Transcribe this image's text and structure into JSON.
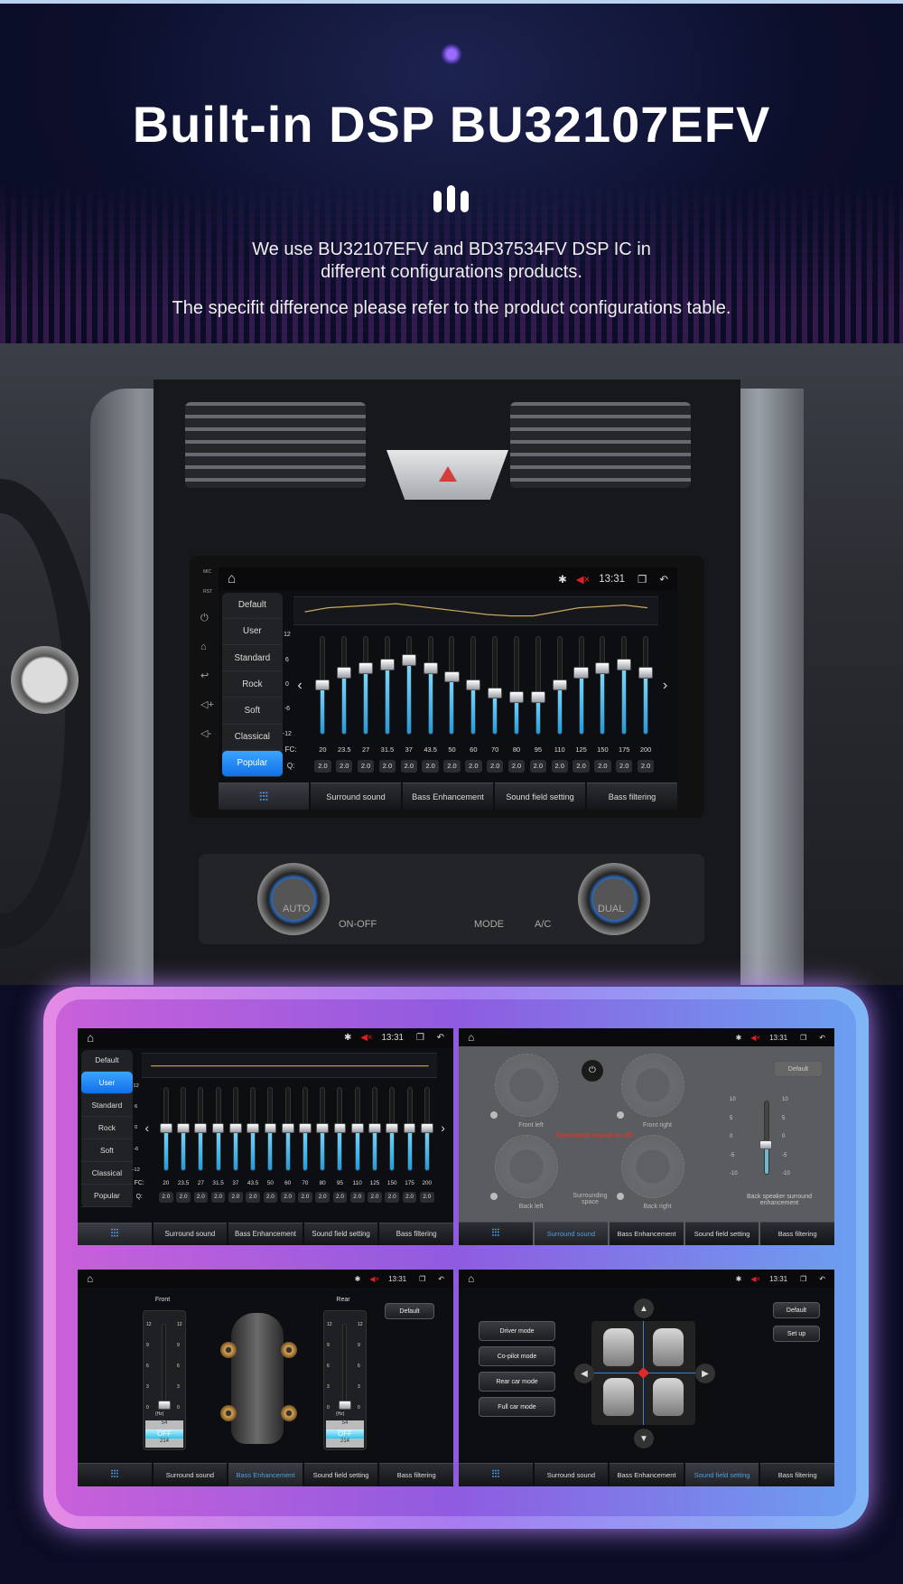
{
  "hero": {
    "title": "Built-in DSP BU32107EFV",
    "line1": "We use BU32107EFV and BD37534FV DSP IC in",
    "line2": "different configurations products.",
    "line3": "The specifit difference please refer to the product configurations table."
  },
  "dashboard": {
    "climate_labels": [
      "AUTO",
      "ON-OFF",
      "MODE",
      "A/C",
      "DUAL"
    ],
    "side_labels": [
      "MIC",
      "RST"
    ]
  },
  "status": {
    "time": "13:31",
    "icons": [
      "home-icon",
      "bluetooth-icon",
      "mute-icon",
      "recent-apps-icon",
      "back-icon"
    ],
    "mute_color": "#e02020"
  },
  "tabs": {
    "eq_icon": "equalizer-icon",
    "items": [
      "Surround sound",
      "Bass Enhancement",
      "Sound field setting",
      "Bass filtering"
    ]
  },
  "equalizer": {
    "presets": [
      "Default",
      "User",
      "Standard",
      "Rock",
      "Soft",
      "Classical",
      "Popular"
    ],
    "scale": [
      "12",
      "6",
      "0",
      "-6",
      "-12"
    ],
    "range_db": [
      -12,
      12
    ],
    "fc_label": "FC:",
    "q_label": "Q:",
    "frequencies": [
      "20",
      "23.5",
      "27",
      "31.5",
      "37",
      "43.5",
      "50",
      "60",
      "70",
      "80",
      "95",
      "110",
      "125",
      "150",
      "175",
      "200"
    ],
    "q_values": [
      "2.0",
      "2.0",
      "2.0",
      "2.0",
      "2.0",
      "2.0",
      "2.0",
      "2.0",
      "2.0",
      "2.0",
      "2.0",
      "2.0",
      "2.0",
      "2.0",
      "2.0",
      "2.0"
    ],
    "popular_gains_db": [
      0,
      3,
      4,
      5,
      6,
      4,
      2,
      0,
      -2,
      -3,
      -3,
      0,
      3,
      4,
      5,
      3
    ],
    "user_gains_db": [
      0,
      0,
      0,
      0,
      0,
      0,
      0,
      0,
      0,
      0,
      0,
      0,
      0,
      0,
      0,
      0
    ],
    "main_selected": "Popular",
    "small_selected": "User",
    "accent": "#1e9be0"
  },
  "surround": {
    "default_label": "Default",
    "off_message": "Surround sound is off",
    "off_color": "#d03a2a",
    "speakers": [
      "Front left",
      "Front right",
      "Back left",
      "Back right"
    ],
    "space_label": "Surrounding space",
    "back_label": "Back speaker surround enhancement",
    "scale": [
      "10",
      "5",
      "0",
      "-5",
      "-10"
    ],
    "back_level": -2
  },
  "bass": {
    "front_label": "Front",
    "rear_label": "Rear",
    "default_label": "Default",
    "scale": [
      "12",
      "9",
      "6",
      "3",
      "0"
    ],
    "unit": "(Hz)",
    "options": [
      "54",
      "OFF",
      "214"
    ],
    "selected": "OFF"
  },
  "soundfield": {
    "modes": [
      "Driver mode",
      "Co-pilot mode",
      "Rear car mode",
      "Full car mode"
    ],
    "default_label": "Default",
    "setup_label": "Set up"
  }
}
